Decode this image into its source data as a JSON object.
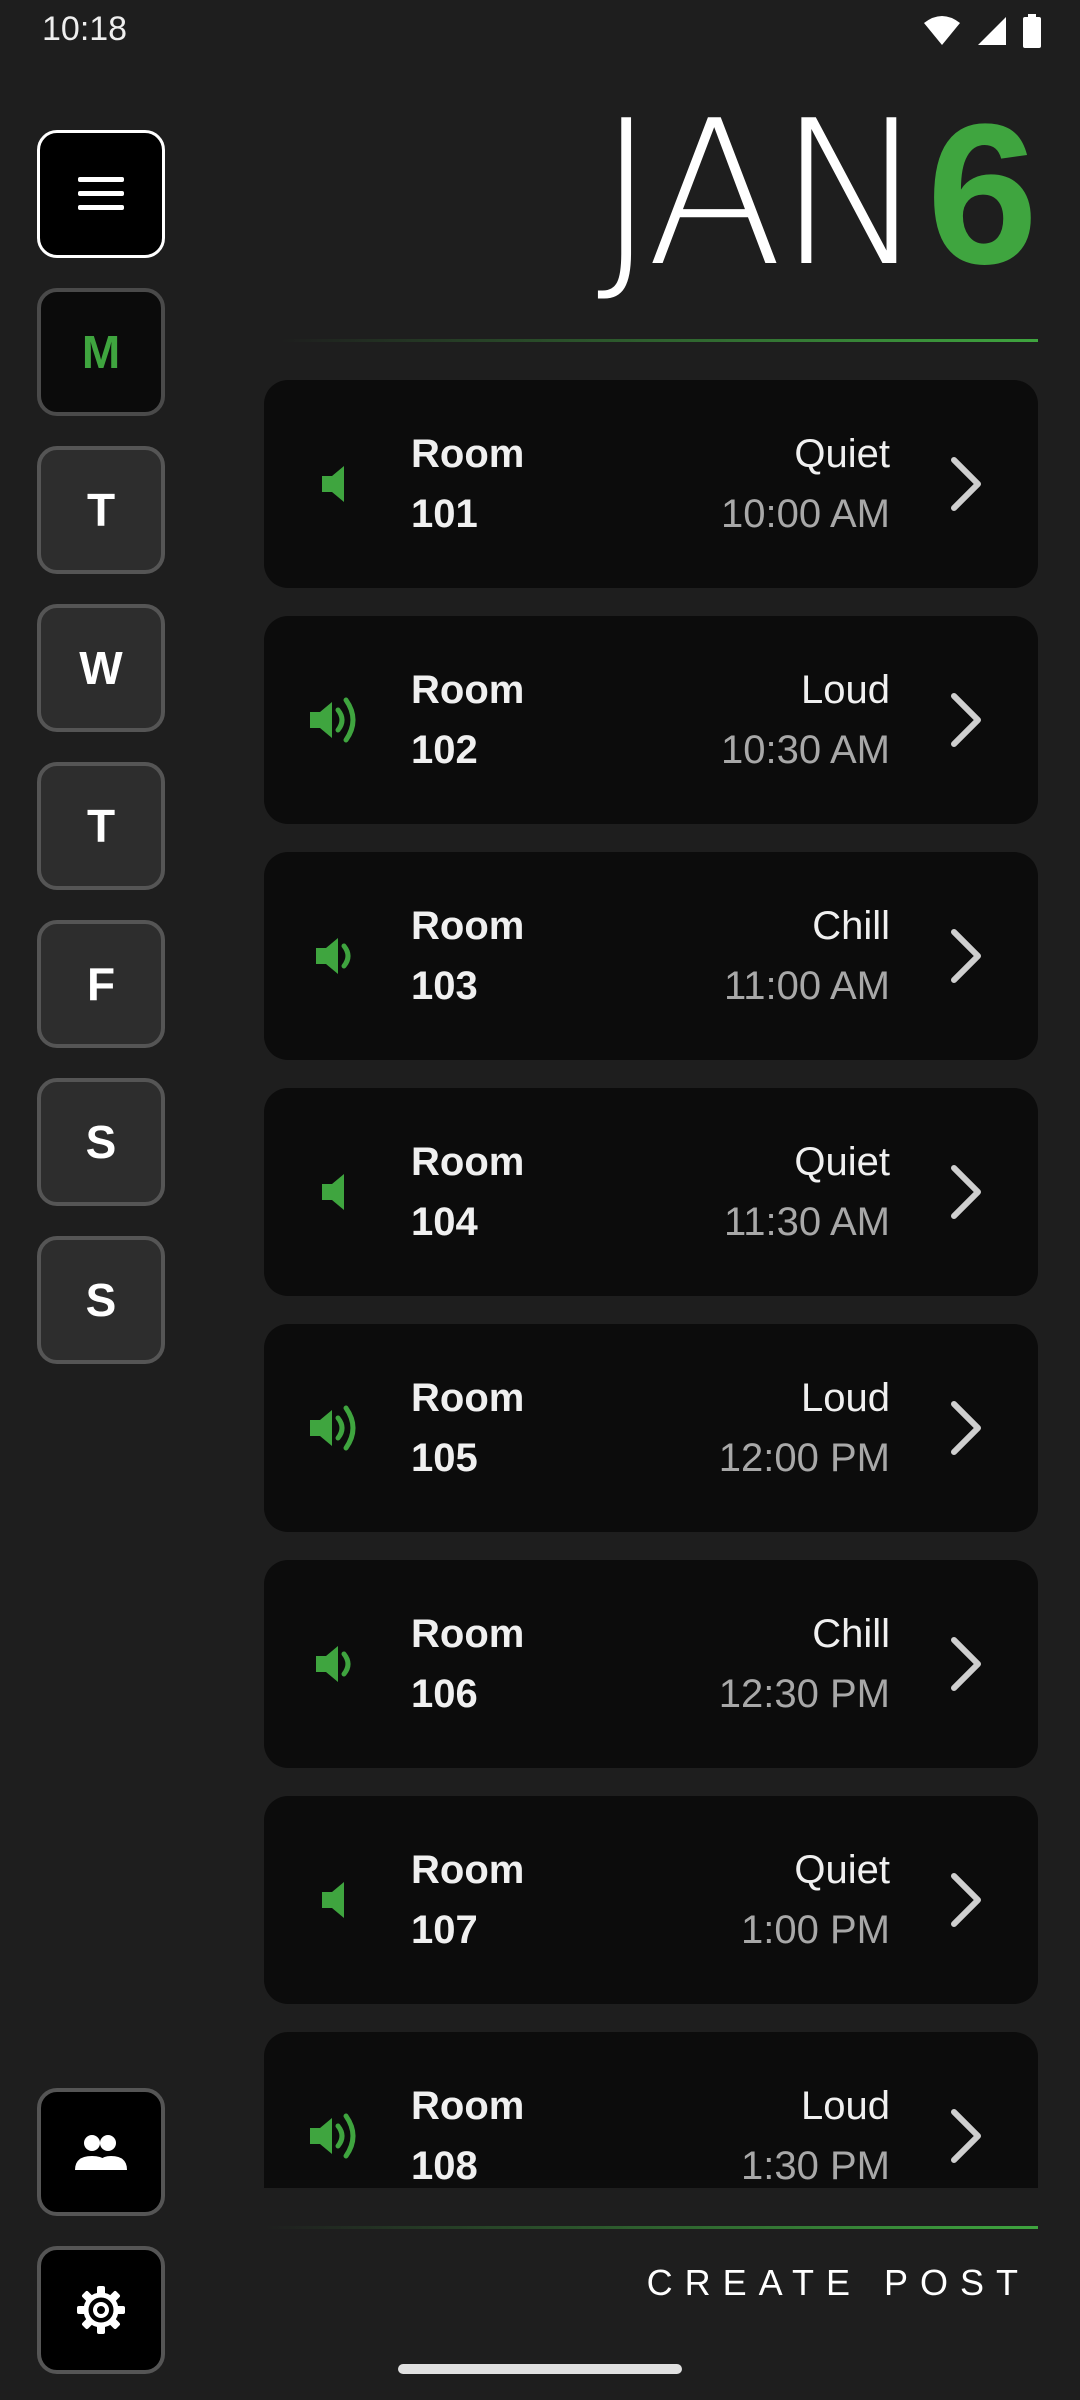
{
  "status": {
    "time": "10:18"
  },
  "header": {
    "month": "JAN",
    "day": "6"
  },
  "sidebar": {
    "days": [
      {
        "label": "M",
        "selected": true
      },
      {
        "label": "T",
        "selected": false
      },
      {
        "label": "W",
        "selected": false
      },
      {
        "label": "T",
        "selected": false
      },
      {
        "label": "F",
        "selected": false
      },
      {
        "label": "S",
        "selected": false
      },
      {
        "label": "S",
        "selected": false
      }
    ]
  },
  "rooms": [
    {
      "label": "Room",
      "number": "101",
      "vibe": "Quiet",
      "time": "10:00 AM",
      "icon": "volume-low-icon"
    },
    {
      "label": "Room",
      "number": "102",
      "vibe": "Loud",
      "time": "10:30 AM",
      "icon": "volume-high-icon"
    },
    {
      "label": "Room",
      "number": "103",
      "vibe": "Chill",
      "time": "11:00 AM",
      "icon": "volume-medium-icon"
    },
    {
      "label": "Room",
      "number": "104",
      "vibe": "Quiet",
      "time": "11:30 AM",
      "icon": "volume-low-icon"
    },
    {
      "label": "Room",
      "number": "105",
      "vibe": "Loud",
      "time": "12:00 PM",
      "icon": "volume-high-icon"
    },
    {
      "label": "Room",
      "number": "106",
      "vibe": "Chill",
      "time": "12:30 PM",
      "icon": "volume-medium-icon"
    },
    {
      "label": "Room",
      "number": "107",
      "vibe": "Quiet",
      "time": "1:00 PM",
      "icon": "volume-low-icon"
    },
    {
      "label": "Room",
      "number": "108",
      "vibe": "Loud",
      "time": "1:30 PM",
      "icon": "volume-high-icon"
    }
  ],
  "footer": {
    "create_post": "CREATE POST"
  },
  "colors": {
    "accent": "#3fa53f",
    "background": "#1e1e1e",
    "card": "#0c0c0c"
  }
}
